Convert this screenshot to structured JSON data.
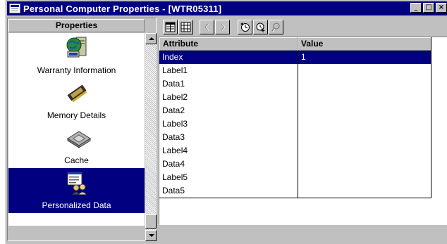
{
  "window": {
    "title": "Personal Computer Properties - [WTR05311]",
    "minimize_glyph": "_",
    "restore_glyph": "□",
    "close_glyph": "×"
  },
  "properties_panel": {
    "header": "Properties",
    "items": [
      {
        "label": "Warranty Information",
        "icon": "warranty-icon",
        "selected": false
      },
      {
        "label": "Memory Details",
        "icon": "memory-chip-icon",
        "selected": false
      },
      {
        "label": "Cache",
        "icon": "cache-chip-icon",
        "selected": false
      },
      {
        "label": "Personalized Data",
        "icon": "personalized-data-icon",
        "selected": true
      }
    ]
  },
  "toolbar": {
    "buttons": [
      {
        "icon": "form-view-icon",
        "enabled": true
      },
      {
        "icon": "grid-view-icon",
        "enabled": true
      },
      {
        "icon": "previous-icon",
        "enabled": false
      },
      {
        "icon": "next-icon",
        "enabled": false
      },
      {
        "icon": "clock-icon",
        "enabled": true
      },
      {
        "icon": "clock-cursor-icon",
        "enabled": true
      },
      {
        "icon": "search-icon",
        "enabled": false
      }
    ]
  },
  "grid": {
    "columns": [
      "Attribute",
      "Value"
    ],
    "rows": [
      {
        "attribute": "Index",
        "value": "1",
        "selected": true
      },
      {
        "attribute": "Label1",
        "value": ""
      },
      {
        "attribute": "Data1",
        "value": ""
      },
      {
        "attribute": "Label2",
        "value": ""
      },
      {
        "attribute": "Data2",
        "value": ""
      },
      {
        "attribute": "Label3",
        "value": ""
      },
      {
        "attribute": "Data3",
        "value": ""
      },
      {
        "attribute": "Label4",
        "value": ""
      },
      {
        "attribute": "Data4",
        "value": ""
      },
      {
        "attribute": "Label5",
        "value": ""
      },
      {
        "attribute": "Data5",
        "value": ""
      }
    ]
  },
  "colors": {
    "titlebar": "#000080",
    "selection": "#000080",
    "face": "#c0c0c0"
  }
}
